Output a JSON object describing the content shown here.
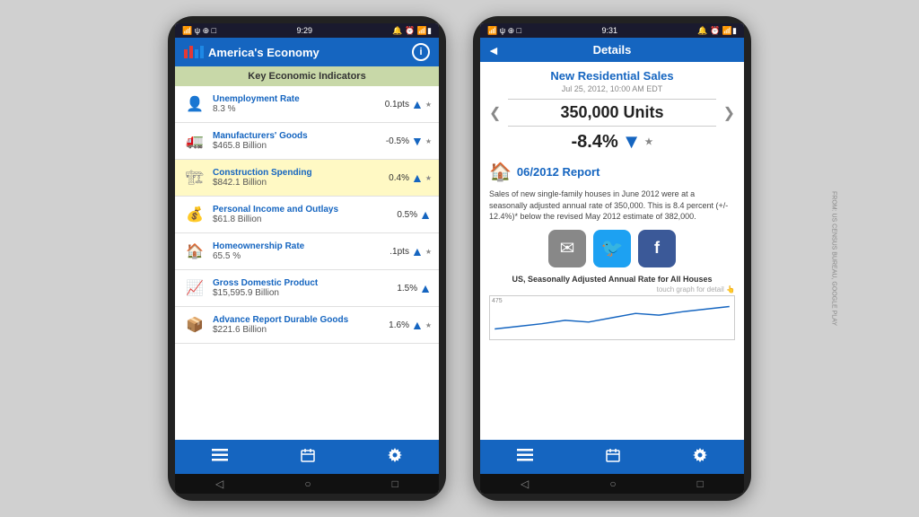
{
  "left_phone": {
    "status_bar": {
      "left": "📶 ψ ⊕ □",
      "time": "9:29",
      "right": "🔔 ⏰ 📶▮"
    },
    "header": {
      "title": "America's Economy",
      "info_label": "i"
    },
    "section": {
      "label": "Key Economic Indicators"
    },
    "indicators": [
      {
        "icon": "👤",
        "name": "Unemployment Rate",
        "value": "8.3 %",
        "change": "0.1pts",
        "direction": "up",
        "starred": true,
        "highlighted": false
      },
      {
        "icon": "🚛",
        "name": "Manufacturers' Goods",
        "value": "$465.8 Billion",
        "change": "-0.5%",
        "direction": "down",
        "starred": true,
        "highlighted": false
      },
      {
        "icon": "🏗",
        "name": "Construction Spending",
        "value": "$842.1 Billion",
        "change": "0.4%",
        "direction": "up",
        "starred": true,
        "highlighted": true
      },
      {
        "icon": "💰",
        "name": "Personal Income and Outlays",
        "value": "$61.8 Billion",
        "change": "0.5%",
        "direction": "up",
        "starred": false,
        "highlighted": false
      },
      {
        "icon": "🏠",
        "name": "Homeownership Rate",
        "value": "65.5 %",
        "change": ".1pts",
        "direction": "up",
        "starred": true,
        "highlighted": false
      },
      {
        "icon": "📈",
        "name": "Gross Domestic Product",
        "value": "$15,595.9 Billion",
        "change": "1.5%",
        "direction": "up",
        "starred": false,
        "highlighted": false
      },
      {
        "icon": "📦",
        "name": "Advance Report Durable Goods",
        "value": "$221.6 Billion",
        "change": "1.6%",
        "direction": "up",
        "starred": true,
        "highlighted": false
      }
    ],
    "bottom_nav": {
      "items": [
        "≡",
        "📅",
        "⚙"
      ]
    },
    "android_nav": {
      "back": "◁",
      "home": "○",
      "recent": "□"
    }
  },
  "right_phone": {
    "status_bar": {
      "left": "📶 ψ ⊕ □",
      "time": "9:31",
      "right": "🔔 ⏰ 📶▮"
    },
    "header": {
      "back_label": "◄",
      "title": "Details"
    },
    "details": {
      "name": "New Residential Sales",
      "date": "Jul 25, 2012, 10:00 AM EDT",
      "units": "350,000 Units",
      "change": "-8.4%",
      "direction": "down",
      "starred": true,
      "report_label": "06/2012 Report",
      "report_text": "Sales of new single-family houses in June 2012 were at a seasonally adjusted annual rate of 350,000. This is 8.4 percent (+/- 12.4%)* below the revised May 2012 estimate of 382,000."
    },
    "share": {
      "email_icon": "✉",
      "twitter_icon": "🐦",
      "facebook_icon": "f"
    },
    "graph": {
      "caption": "US, Seasonally Adjusted Annual Rate for All Houses",
      "touch_hint": "touch graph for detail",
      "y_label": "475"
    },
    "bottom_nav": {
      "items": [
        "≡",
        "📅",
        "⚙"
      ]
    },
    "android_nav": {
      "back": "◁",
      "home": "○",
      "recent": "□"
    },
    "source": "FROM: US CENSUS BUREAU, GOOGLE PLAY"
  }
}
